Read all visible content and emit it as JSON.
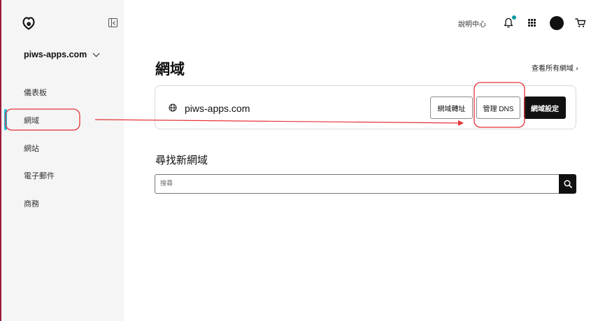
{
  "sidebar": {
    "account": "piws-apps.com",
    "items": [
      {
        "label": "儀表板"
      },
      {
        "label": "網域"
      },
      {
        "label": "網站"
      },
      {
        "label": "電子郵件"
      },
      {
        "label": "商務"
      }
    ],
    "active_item": "網域"
  },
  "header": {
    "help": "說明中心"
  },
  "main": {
    "title": "網域",
    "view_all": "查看所有網域 ›",
    "domain": {
      "name": "piws-apps.com",
      "forward_button": "網域轉址",
      "dns_button": "管理 DNS",
      "settings_button": "網域設定"
    },
    "find": {
      "title": "尋找新網域",
      "placeholder": "搜尋"
    }
  },
  "colors": {
    "accent": "#1bbdd4",
    "annotation": "#e53238",
    "primary_button": "#111111"
  },
  "icons": [
    "godaddy-logo-icon",
    "sidebar-collapse-icon",
    "chevron-down-icon",
    "bell-icon",
    "apps-grid-icon",
    "avatar",
    "cart-icon",
    "globe-icon",
    "search-icon"
  ]
}
